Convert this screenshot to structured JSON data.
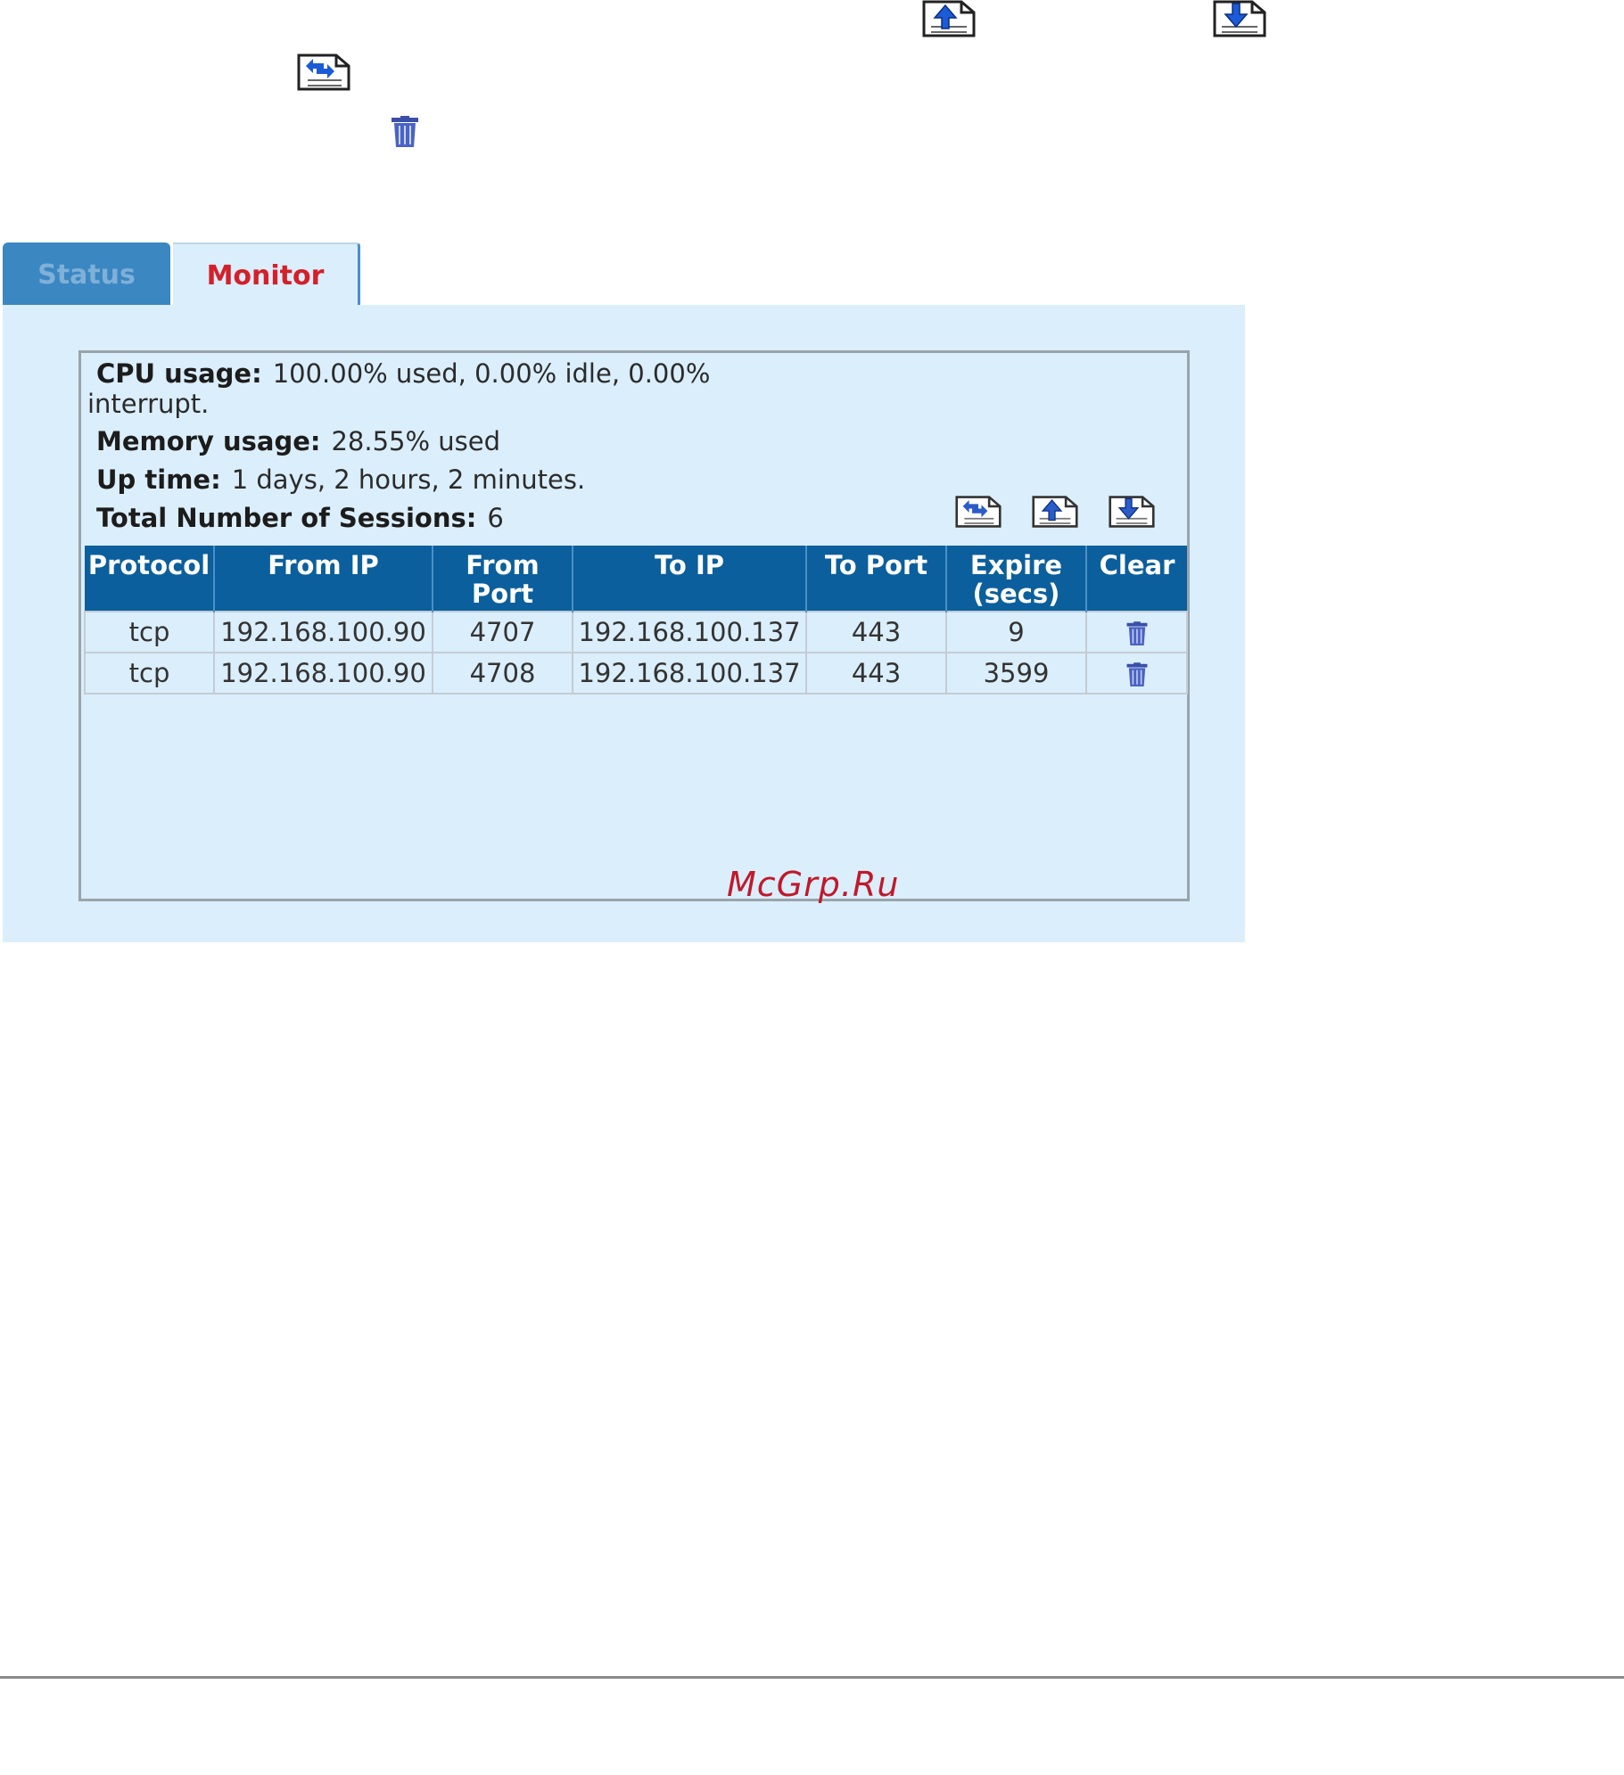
{
  "tabs": [
    {
      "label": "Status",
      "active": false
    },
    {
      "label": "Monitor",
      "active": true
    }
  ],
  "stats": {
    "cpu_label": "CPU usage:",
    "cpu_value_line1": "100.00% used,   0.00% idle,    0.00%",
    "cpu_value_line2": "interrupt.",
    "memory_label": "Memory usage:",
    "memory_value": "28.55% used",
    "uptime_label": "Up time:",
    "uptime_value": "1 days,  2 hours,  2 minutes.",
    "sessions_label": "Total Number of Sessions:",
    "sessions_value": "6"
  },
  "table": {
    "headers": [
      "Protocol",
      "From IP",
      "From Port",
      "To IP",
      "To Port",
      "Expire (secs)",
      "Clear"
    ],
    "rows": [
      {
        "protocol": "tcp",
        "from_ip": "192.168.100.90",
        "from_port": "4707",
        "to_ip": "192.168.100.137",
        "to_port": "443",
        "expire": "9"
      },
      {
        "protocol": "tcp",
        "from_ip": "192.168.100.90",
        "from_port": "4708",
        "to_ip": "192.168.100.137",
        "to_port": "443",
        "expire": "3599"
      }
    ]
  },
  "icons": {
    "refresh": "refresh-doc-icon",
    "page_up": "page-up-doc-icon",
    "page_down": "page-down-doc-icon",
    "clear": "trash-icon"
  },
  "colors": {
    "header_blue": "#0b5f9c",
    "panel_bg": "#dbeefb",
    "active_tab_text": "#d4202a",
    "inactive_tab_bg": "#3a87c2"
  },
  "watermark": "McGrp.Ru"
}
